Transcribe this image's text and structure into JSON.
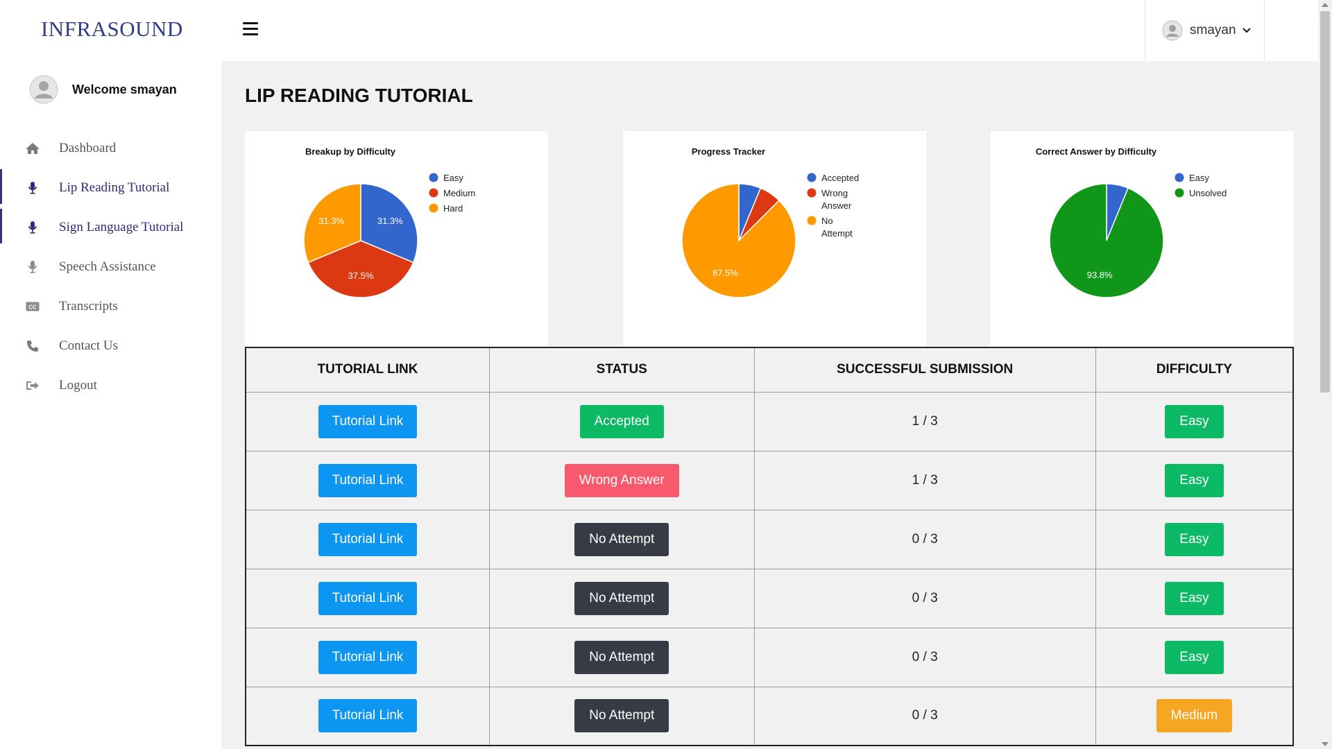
{
  "app": {
    "brand": "INFRASOUND"
  },
  "header": {
    "username": "smayan"
  },
  "sidebar": {
    "welcome": "Welcome smayan",
    "items": [
      {
        "label": "Dashboard",
        "icon": "home-icon",
        "active": false
      },
      {
        "label": "Lip Reading Tutorial",
        "icon": "microphone-icon",
        "active": true
      },
      {
        "label": "Sign Language Tutorial",
        "icon": "microphone-icon",
        "active": true
      },
      {
        "label": "Speech Assistance",
        "icon": "microphone-icon",
        "active": false
      },
      {
        "label": "Transcripts",
        "icon": "closed-caption-icon",
        "active": false
      },
      {
        "label": "Contact Us",
        "icon": "phone-icon",
        "active": false
      },
      {
        "label": "Logout",
        "icon": "logout-icon",
        "active": false
      }
    ]
  },
  "main": {
    "title": "LIP READING TUTORIAL"
  },
  "colors": {
    "blue": "#3366cc",
    "red": "#dc3912",
    "orange": "#ff9900",
    "green": "#109618"
  },
  "chart_data": [
    {
      "type": "pie",
      "title": "Breakup by Difficulty",
      "labels": [
        "Easy",
        "Medium",
        "Hard"
      ],
      "values": [
        31.3,
        37.5,
        31.3
      ],
      "value_labels": [
        "31.3%",
        "37.5%",
        "31.3%"
      ],
      "colors": [
        "#3366cc",
        "#dc3912",
        "#ff9900"
      ],
      "legend": "right"
    },
    {
      "type": "pie",
      "title": "Progress Tracker",
      "labels": [
        "Accepted",
        "Wrong Answer",
        "No Attempt"
      ],
      "values": [
        6.25,
        6.25,
        87.5
      ],
      "value_labels": [
        "",
        "",
        "87.5%"
      ],
      "colors": [
        "#3366cc",
        "#dc3912",
        "#ff9900"
      ],
      "legend": "right"
    },
    {
      "type": "pie",
      "title": "Correct Answer by Difficulty",
      "labels": [
        "Easy",
        "Unsolved"
      ],
      "values": [
        6.2,
        93.8
      ],
      "value_labels": [
        "",
        "93.8%"
      ],
      "colors": [
        "#3366cc",
        "#109618"
      ],
      "legend": "right"
    }
  ],
  "table": {
    "headers": [
      "TUTORIAL LINK",
      "STATUS",
      "SUCCESSFUL SUBMISSION",
      "DIFFICULTY"
    ],
    "rows": [
      {
        "link": "Tutorial Link",
        "status": "Accepted",
        "status_kind": "accepted",
        "submission": "1 / 3",
        "difficulty": "Easy",
        "difficulty_kind": "easy"
      },
      {
        "link": "Tutorial Link",
        "status": "Wrong Answer",
        "status_kind": "wrong",
        "submission": "1 / 3",
        "difficulty": "Easy",
        "difficulty_kind": "easy"
      },
      {
        "link": "Tutorial Link",
        "status": "No Attempt",
        "status_kind": "none",
        "submission": "0 / 3",
        "difficulty": "Easy",
        "difficulty_kind": "easy"
      },
      {
        "link": "Tutorial Link",
        "status": "No Attempt",
        "status_kind": "none",
        "submission": "0 / 3",
        "difficulty": "Easy",
        "difficulty_kind": "easy"
      },
      {
        "link": "Tutorial Link",
        "status": "No Attempt",
        "status_kind": "none",
        "submission": "0 / 3",
        "difficulty": "Easy",
        "difficulty_kind": "easy"
      },
      {
        "link": "Tutorial Link",
        "status": "No Attempt",
        "status_kind": "none",
        "submission": "0 / 3",
        "difficulty": "Medium",
        "difficulty_kind": "medium"
      }
    ]
  }
}
